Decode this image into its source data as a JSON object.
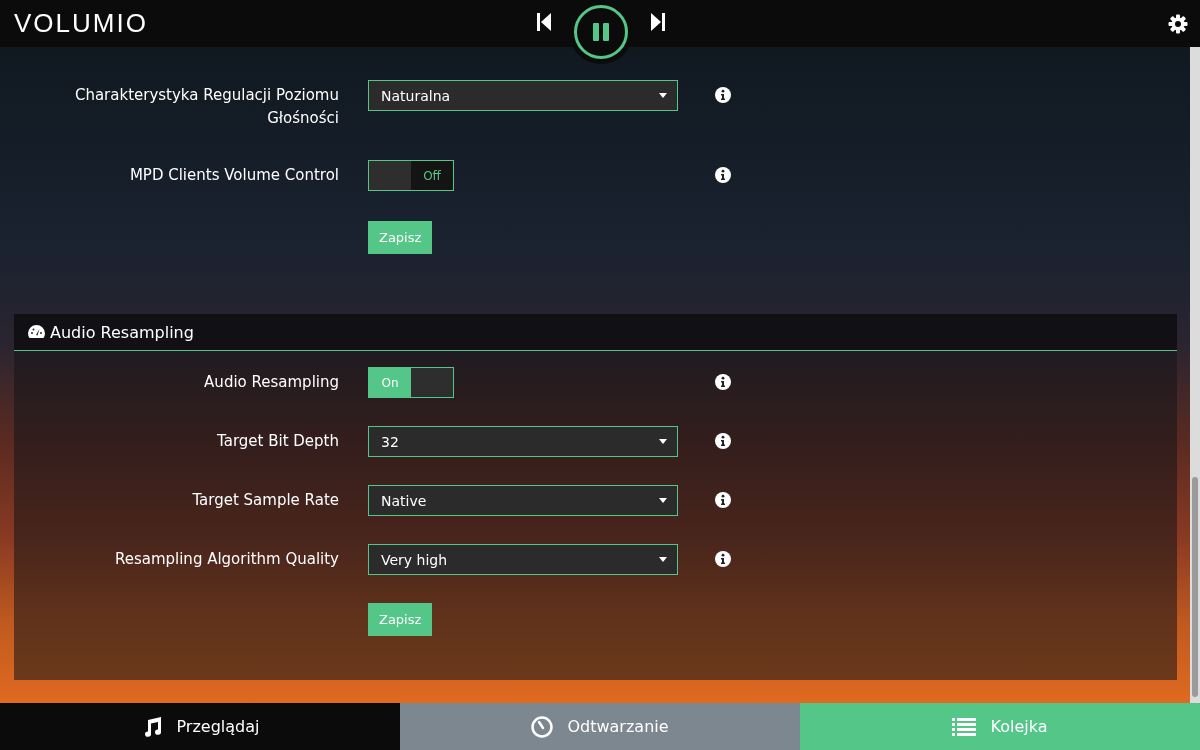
{
  "header": {
    "logo": "VOLUMIO",
    "playing": true
  },
  "volume_rows": [
    {
      "kind": "select",
      "label": "Charakterystyka Regulacji Poziomu Głośności",
      "value": "Naturalna"
    },
    {
      "kind": "toggle",
      "label": "MPD Clients Volume Control",
      "on": false,
      "text": "Off"
    }
  ],
  "volume_save": "Zapisz",
  "resampling": {
    "title": "Audio Resampling",
    "rows": [
      {
        "kind": "toggle",
        "label": "Audio Resampling",
        "on": true,
        "text": "On"
      },
      {
        "kind": "select",
        "label": "Target Bit Depth",
        "value": "32"
      },
      {
        "kind": "select",
        "label": "Target Sample Rate",
        "value": "Native"
      },
      {
        "kind": "select",
        "label": "Resampling Algorithm Quality",
        "value": "Very high"
      }
    ],
    "save": "Zapisz"
  },
  "nav": [
    {
      "label": "Przeglądaj",
      "kind": "browse",
      "selected": false,
      "hovered": false
    },
    {
      "label": "Odtwarzanie",
      "kind": "playback",
      "selected": false,
      "hovered": true
    },
    {
      "label": "Kolejka",
      "kind": "queue",
      "selected": true,
      "hovered": false
    }
  ]
}
